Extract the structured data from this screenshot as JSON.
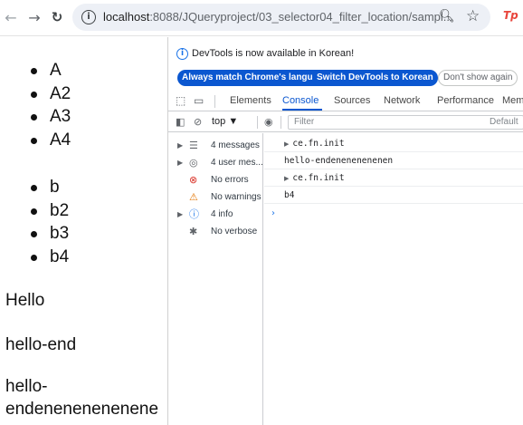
{
  "browser": {
    "url_host": "localhost",
    "url_path": ":8088/JQueryproject/03_selector04_filter_location/sampl...",
    "ext_label": "Tp"
  },
  "page": {
    "list1": [
      "A",
      "A2",
      "A3",
      "A4"
    ],
    "list2": [
      "b",
      "b2",
      "b3",
      "b4"
    ],
    "paragraphs": [
      "Hello",
      "hello-end",
      "hello-",
      "endenenenenenene"
    ]
  },
  "devtools": {
    "info_message": "DevTools is now available in Korean!",
    "buttons": {
      "match_language": "Always match Chrome's language",
      "switch_korean": "Switch DevTools to Korean",
      "dont_show": "Don't show again"
    },
    "tabs": [
      "Elements",
      "Console",
      "Sources",
      "Network",
      "Performance",
      "Mem"
    ],
    "active_tab": "Console",
    "context": "top ▼",
    "filter_placeholder": "Filter",
    "levels_label": "Default",
    "sidebar": [
      {
        "label": "4 messages",
        "icon": "list-icon",
        "has_arrow": true
      },
      {
        "label": "4 user mes...",
        "icon": "user-icon",
        "has_arrow": true
      },
      {
        "label": "No errors",
        "icon": "error-icon",
        "has_arrow": false
      },
      {
        "label": "No warnings",
        "icon": "warning-icon",
        "has_arrow": false
      },
      {
        "label": "4 info",
        "icon": "info-icon",
        "has_arrow": true
      },
      {
        "label": "No verbose",
        "icon": "bug-icon",
        "has_arrow": false
      }
    ],
    "log": [
      {
        "text": "ce.fn.init",
        "expandable": true
      },
      {
        "text": "hello-endenenenenenen",
        "expandable": false
      },
      {
        "text": "ce.fn.init",
        "expandable": true
      },
      {
        "text": "b4",
        "expandable": false
      }
    ]
  }
}
